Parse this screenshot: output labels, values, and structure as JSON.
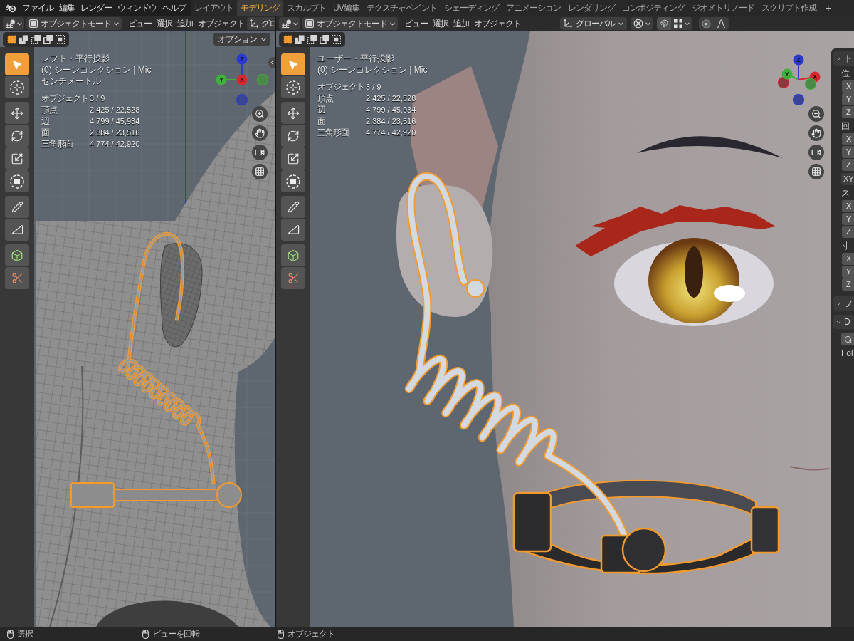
{
  "top_bar": {
    "menus": [
      "ファイル",
      "編集",
      "レンダー",
      "ウィンドウ",
      "ヘルプ"
    ],
    "workspace_tabs": [
      {
        "label": "レイアウト",
        "selected": false
      },
      {
        "label": "モデリング",
        "selected": true
      },
      {
        "label": "スカルプト",
        "selected": false
      },
      {
        "label": "UV編集",
        "selected": false
      },
      {
        "label": "テクスチャペイント",
        "selected": false
      },
      {
        "label": "シェーディング",
        "selected": false
      },
      {
        "label": "アニメーション",
        "selected": false
      },
      {
        "label": "レンダリング",
        "selected": false
      },
      {
        "label": "コンポジティング",
        "selected": false
      },
      {
        "label": "ジオメトリノード",
        "selected": false
      },
      {
        "label": "スクリプト作成",
        "selected": false
      }
    ],
    "add_tab": "+"
  },
  "viewports": [
    {
      "kind": "left_ortho",
      "header": {
        "mode": "オブジェクトモード",
        "menus": [
          "ビュー",
          "選択",
          "追加",
          "オブジェクト"
        ],
        "orientation": {
          "label": "グロ",
          "dropdown": false
        }
      },
      "options": "オプション",
      "select_modes": [
        {
          "kind": "set",
          "selected": true
        },
        {
          "kind": "extend",
          "selected": false
        },
        {
          "kind": "subtract",
          "selected": false
        },
        {
          "kind": "difference",
          "selected": false
        },
        {
          "kind": "intersect",
          "selected": false
        }
      ],
      "tool_groups": [
        [
          {
            "kind": "select",
            "selected": true
          },
          {
            "kind": "cursor",
            "selected": false
          }
        ],
        [
          {
            "kind": "move",
            "selected": false
          },
          {
            "kind": "rotate",
            "selected": false
          },
          {
            "kind": "scale",
            "selected": false
          },
          {
            "kind": "transform",
            "selected": false
          }
        ],
        [
          {
            "kind": "annotate",
            "selected": false
          },
          {
            "kind": "measure",
            "selected": false
          }
        ],
        [
          {
            "kind": "add_cube",
            "selected": false
          },
          {
            "kind": "cut",
            "selected": false
          }
        ]
      ],
      "info": {
        "lines": [
          "レフト・平行投影",
          "(0) シーンコレクション | Mic",
          "センチメートル"
        ],
        "stats": [
          {
            "label": "オブジェクト",
            "value": "3 / 9"
          },
          {
            "label": "頂点",
            "value": "2,425 / 22,528"
          },
          {
            "label": "辺",
            "value": "4,799 / 45,934"
          },
          {
            "label": "面",
            "value": "2,384 / 23,516"
          },
          {
            "label": "三角形面",
            "value": "4,774 / 42,920"
          }
        ]
      },
      "gizmo": {
        "x": "X",
        "y": "Y",
        "z": "Z"
      }
    },
    {
      "kind": "user_ortho",
      "header": {
        "mode": "オブジェクトモード",
        "menus": [
          "ビュー",
          "選択",
          "追加",
          "オブジェクト"
        ],
        "orientation": {
          "label": "グローバル",
          "dropdown": true
        },
        "extra_controls": [
          {
            "kind": "pivot"
          },
          {
            "kind": "snap"
          },
          {
            "kind": "snap_target"
          },
          {
            "kind": "proportional"
          },
          {
            "kind": "falloff"
          }
        ]
      },
      "select_modes": [
        {
          "kind": "set",
          "selected": true
        },
        {
          "kind": "extend",
          "selected": false
        },
        {
          "kind": "subtract",
          "selected": false
        },
        {
          "kind": "difference",
          "selected": false
        },
        {
          "kind": "intersect",
          "selected": false
        }
      ],
      "tool_groups": [
        [
          {
            "kind": "select",
            "selected": true
          },
          {
            "kind": "cursor",
            "selected": false
          }
        ],
        [
          {
            "kind": "move",
            "selected": false
          },
          {
            "kind": "rotate",
            "selected": false
          },
          {
            "kind": "scale",
            "selected": false
          },
          {
            "kind": "transform",
            "selected": false
          }
        ],
        [
          {
            "kind": "annotate",
            "selected": false
          },
          {
            "kind": "measure",
            "selected": false
          }
        ],
        [
          {
            "kind": "add_cube",
            "selected": false
          },
          {
            "kind": "cut",
            "selected": false
          }
        ]
      ],
      "info": {
        "lines": [
          "ユーザー・平行投影",
          "(0) シーンコレクション | Mic"
        ],
        "stats": [
          {
            "label": "オブジェクト",
            "value": "3 / 9"
          },
          {
            "label": "頂点",
            "value": "2,425 / 22,528"
          },
          {
            "label": "辺",
            "value": "4,799 / 45,934"
          },
          {
            "label": "面",
            "value": "2,384 / 23,516"
          },
          {
            "label": "三角形面",
            "value": "4,774 / 42,920"
          }
        ]
      },
      "gizmo": {
        "x": "X",
        "y": "Y",
        "z": "Z"
      },
      "sidebar": {
        "panels": [
          {
            "title": "ト",
            "expanded": true,
            "rows": [
              {
                "kind": "label",
                "text": "位"
              },
              {
                "kind": "field",
                "text": "X"
              },
              {
                "kind": "field",
                "text": "Y"
              },
              {
                "kind": "field",
                "text": "Z"
              },
              {
                "kind": "label",
                "text": "回"
              },
              {
                "kind": "field",
                "text": "X"
              },
              {
                "kind": "field",
                "text": "Y"
              },
              {
                "kind": "field",
                "text": "Z"
              },
              {
                "kind": "dropdown",
                "text": "XY"
              },
              {
                "kind": "label",
                "text": "ス"
              },
              {
                "kind": "field",
                "text": "X"
              },
              {
                "kind": "field",
                "text": "Y"
              },
              {
                "kind": "field",
                "text": "Z"
              },
              {
                "kind": "label",
                "text": "寸"
              },
              {
                "kind": "field",
                "text": "X"
              },
              {
                "kind": "field",
                "text": "Y"
              },
              {
                "kind": "field",
                "text": "Z"
              }
            ]
          },
          {
            "title": "フ",
            "expanded": false
          },
          {
            "title": "D",
            "expanded": true,
            "rows": [
              {
                "kind": "icon_button"
              },
              {
                "kind": "label",
                "text": "Fol"
              }
            ]
          }
        ]
      }
    }
  ],
  "status_bar": [
    "選択",
    "ビューを回転",
    "オブジェクト"
  ]
}
